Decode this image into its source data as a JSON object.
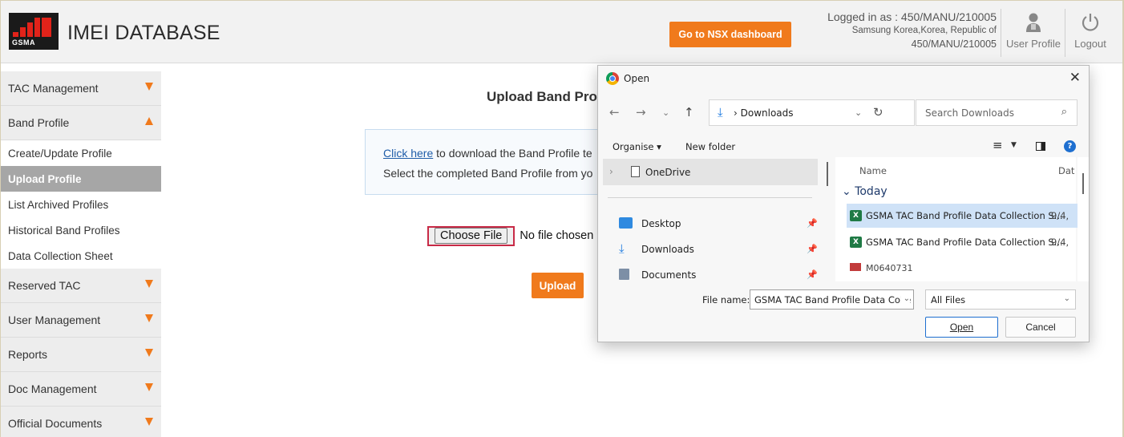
{
  "header": {
    "logo_text": "GSMA",
    "app_title": "IMEI DATABASE",
    "nsx_button": "Go to NSX dashboard",
    "login_line1": "Logged in as : 450/MANU/210005",
    "login_line2": "Samsung Korea,Korea, Republic of",
    "login_line3": "450/MANU/210005",
    "user_profile": "User Profile",
    "logout": "Logout"
  },
  "sidebar": {
    "tac_management": "TAC Management",
    "band_profile": "Band Profile",
    "band_sub": [
      "Create/Update Profile",
      "Upload Profile",
      "List Archived Profiles",
      "Historical Band Profiles",
      "Data Collection Sheet"
    ],
    "reserved_tac": "Reserved TAC",
    "user_management": "User Management",
    "reports": "Reports",
    "doc_management": "Doc Management",
    "official_documents": "Official Documents"
  },
  "main": {
    "heading": "Upload Band Profile",
    "info_link": "Click here",
    "info_line1_rest": " to download the Band Profile te",
    "info_line2": "Select the completed Band Profile from yo",
    "choose_file": "Choose File",
    "no_file": "No file chosen",
    "upload_button": "Upload"
  },
  "dialog": {
    "title": "Open",
    "address_path": "Downloads",
    "search_placeholder": "Search Downloads",
    "organise": "Organise ▾",
    "new_folder": "New folder",
    "help": "?",
    "onedrive": "OneDrive",
    "nav_items": [
      "Desktop",
      "Downloads",
      "Documents"
    ],
    "col_name": "Name",
    "col_date": "Dat",
    "group_today": "Today",
    "files": [
      {
        "name": "GSMA TAC Band Profile Data Collection S...",
        "date": "9/4,"
      },
      {
        "name": "GSMA TAC Band Profile Data Collection S...",
        "date": "9/4,"
      }
    ],
    "partial_file": "M0640731",
    "file_name_label": "File name:",
    "file_name_value": "GSMA TAC Band Profile Data Colle",
    "file_type": "All Files",
    "open_button": "Open",
    "cancel_button": "Cancel"
  }
}
